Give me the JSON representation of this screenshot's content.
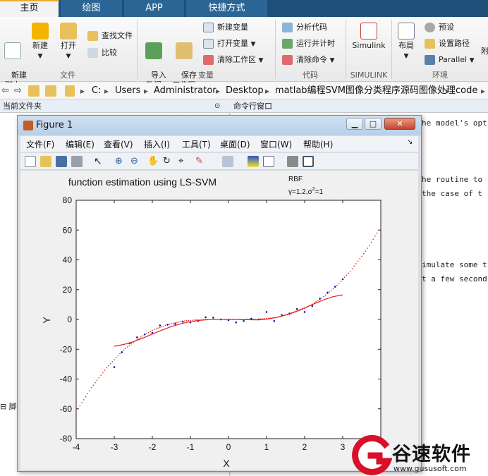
{
  "tabs": [
    "主页",
    "绘图",
    "APP",
    "快捷方式"
  ],
  "ribbon": {
    "file_group": {
      "label": "文件",
      "new_script": "新建\n脚本",
      "new": "新建",
      "open": "打开",
      "find_files": "查找文件",
      "compare": "比较"
    },
    "variable_group": {
      "label": "变量",
      "import_data": "导入\n数据",
      "save_workspace": "保存\n工作区",
      "new_variable": "新建变量",
      "open_variable": "打开变量",
      "clear_workspace": "清除工作区"
    },
    "code_group": {
      "label": "代码",
      "analyze_code": "分析代码",
      "run_and_time": "运行并计时",
      "clear_commands": "清除命令"
    },
    "simulink_group": {
      "label": "SIMULINK",
      "simulink": "Simulink"
    },
    "env_group": {
      "label": "环境",
      "layout": "布局",
      "preferences": "预设",
      "set_path": "设置路径",
      "parallel": "Parallel",
      "more": "附"
    }
  },
  "address": {
    "crumbs": [
      "C:",
      "Users",
      "Administrator",
      "Desktop",
      "matlab编程SVM图像分类程序源码图像处理",
      "code"
    ]
  },
  "panels": {
    "current_folder": "当前文件夹",
    "command_window": "命令行窗口",
    "tree_item": "脚"
  },
  "command_text": {
    "line1": "he model's opt",
    "line2": "he routine to",
    "line3": "the case of t",
    "line4": "imulate some t",
    "line5": "t a few second"
  },
  "figure": {
    "title": "Figure 1",
    "menu": [
      "文件(F)",
      "编辑(E)",
      "查看(V)",
      "插入(I)",
      "工具(T)",
      "桌面(D)",
      "窗口(W)",
      "帮助(H)"
    ],
    "toolbar_icons": [
      "new-figure-icon",
      "open-icon",
      "save-icon",
      "print-icon",
      "pointer-icon",
      "zoom-in-icon",
      "zoom-out-icon",
      "pan-icon",
      "rotate-icon",
      "data-cursor-icon",
      "brush-icon",
      "link-icon",
      "colorbar-icon",
      "legend-icon",
      "hide-tools-icon",
      "show-tools-icon"
    ]
  },
  "chart_data": {
    "type": "scatter",
    "title": "function estimation using  LS-SVM",
    "title_superscript": "RBF",
    "title_subscript": "γ=1.2,σ",
    "title_subscript_exp": "2",
    "title_subscript_tail": "=1",
    "xlabel": "X",
    "ylabel": "Y",
    "xlim": [
      -4,
      4
    ],
    "ylim": [
      -80,
      80
    ],
    "xticks": [
      -4,
      -3,
      -2,
      -1,
      0,
      1,
      2,
      3,
      4
    ],
    "yticks": [
      -80,
      -60,
      -40,
      -20,
      0,
      20,
      40,
      60,
      80
    ],
    "series": [
      {
        "style": "dotted",
        "color": "#e02020",
        "x": [
          -4.0,
          -3.6,
          -3.2,
          -2.8,
          -2.4,
          -2.0,
          -1.6,
          -1.2,
          -0.8,
          -0.4,
          0.0,
          0.4,
          0.8,
          1.2,
          1.6,
          2.0,
          2.4,
          2.8,
          3.2,
          3.6,
          4.0
        ],
        "y": [
          -62,
          -45.8,
          -32.4,
          -21.6,
          -13.3,
          -7.3,
          -3.4,
          -1.1,
          -0.2,
          0.1,
          0.0,
          0.1,
          0.2,
          1.1,
          3.4,
          7.3,
          13.3,
          21.6,
          32.4,
          45.8,
          62
        ]
      },
      {
        "style": "points",
        "color": "#1a1aa0",
        "x": [
          -3.0,
          -2.8,
          -2.6,
          -2.4,
          -2.2,
          -2.0,
          -1.8,
          -1.6,
          -1.4,
          -1.2,
          -1.0,
          -0.8,
          -0.6,
          -0.4,
          -0.2,
          0.0,
          0.2,
          0.4,
          0.6,
          0.8,
          1.0,
          1.2,
          1.4,
          1.6,
          1.8,
          2.0,
          2.2,
          2.4,
          2.6,
          2.8,
          3.0
        ],
        "y": [
          -32,
          -22,
          -16,
          -12,
          -10,
          -9,
          -4,
          -3.5,
          -3,
          -1.5,
          -2,
          -1,
          1.5,
          1.2,
          0,
          -0.5,
          -2,
          -1,
          0.5,
          0,
          5,
          -1,
          3,
          4,
          7,
          5,
          9,
          14,
          18,
          22,
          27
        ]
      },
      {
        "style": "line",
        "color": "#e02020",
        "x": [
          -3.0,
          -2.75,
          -2.5,
          -2.25,
          -2.0,
          -1.75,
          -1.5,
          -1.25,
          -1.0,
          -0.75,
          -0.5,
          -0.25,
          0.0,
          0.25,
          0.5,
          0.75,
          1.0,
          1.25,
          1.5,
          1.75,
          2.0,
          2.25,
          2.5,
          2.75,
          3.0
        ],
        "y": [
          -18,
          -16.8,
          -15,
          -12.5,
          -9.8,
          -7.2,
          -4.8,
          -2.9,
          -1.5,
          -0.6,
          -0.1,
          0.1,
          0.1,
          -0.1,
          -0.2,
          -0.3,
          0.2,
          1.3,
          3.0,
          5.2,
          7.8,
          10.5,
          13.2,
          15.3,
          16.5
        ]
      }
    ]
  },
  "watermark": {
    "text": "谷速软件",
    "url": "www.gususoft.com"
  }
}
